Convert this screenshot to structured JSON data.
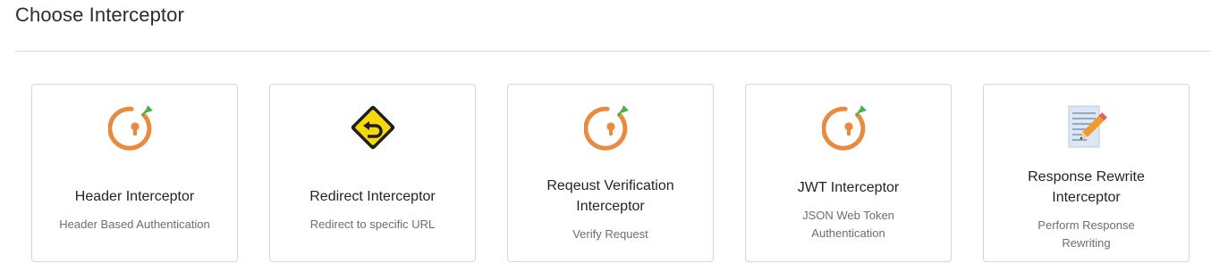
{
  "page": {
    "title": "Choose Interceptor"
  },
  "cards": [
    {
      "icon": "interceptor-power-icon",
      "title": "Header Interceptor",
      "description": "Header Based Authentication"
    },
    {
      "icon": "redirect-sign-icon",
      "title": "Redirect Interceptor",
      "description": "Redirect to specific URL"
    },
    {
      "icon": "interceptor-power-icon",
      "title": "Reqeust Verification Interceptor",
      "description": "Verify Request"
    },
    {
      "icon": "interceptor-power-icon",
      "title": "JWT Interceptor",
      "description": "JSON Web Token Authentication"
    },
    {
      "icon": "document-edit-icon",
      "title": "Response Rewrite Interceptor",
      "description": "Perform Response Rewriting"
    }
  ],
  "colors": {
    "interceptor_orange": "#e98a3e",
    "interceptor_green": "#4caf50",
    "sign_yellow": "#f5d90a",
    "pencil_orange": "#f29a2e"
  }
}
